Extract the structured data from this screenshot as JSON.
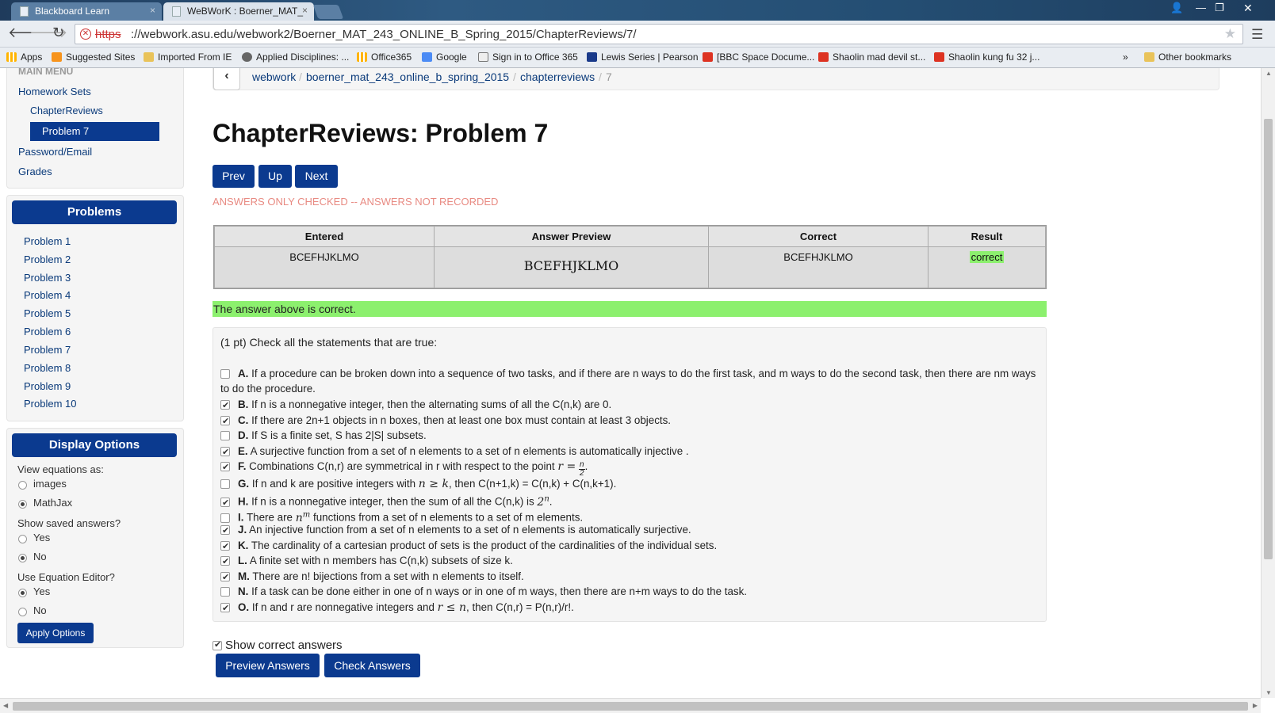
{
  "browser": {
    "tabs": [
      {
        "title": "Blackboard Learn"
      },
      {
        "title": "WeBWorK : Boerner_MAT_"
      }
    ],
    "url_protocol": "https",
    "url_rest": "://webwork.asu.edu/webwork2/Boerner_MAT_243_ONLINE_B_Spring_2015/ChapterReviews/7/",
    "bookmarks": [
      {
        "label": "Apps",
        "icon": "grid-icon"
      },
      {
        "label": "Suggested Sites",
        "icon": "suggested-icon"
      },
      {
        "label": "Imported From IE",
        "icon": "folder-icon"
      },
      {
        "label": "Applied Disciplines: ...",
        "icon": "applied-icon"
      },
      {
        "label": "Office365",
        "icon": "office-icon"
      },
      {
        "label": "Google",
        "icon": "google-icon"
      },
      {
        "label": "Sign in to Office 365",
        "icon": "page-icon"
      },
      {
        "label": "Lewis Series | Pearson",
        "icon": "pearson-icon"
      },
      {
        "label": "[BBC Space Docume...",
        "icon": "youtube-icon"
      },
      {
        "label": "Shaolin mad devil st...",
        "icon": "youtube-icon"
      },
      {
        "label": "Shaolin kung fu 32 j...",
        "icon": "youtube-icon"
      },
      {
        "label": "Other bookmarks",
        "icon": "folder-icon"
      }
    ],
    "more_bookmarks": "»"
  },
  "sidebar": {
    "main_menu": "MAIN MENU",
    "homework_sets": "Homework Sets",
    "chapter_reviews": "ChapterReviews",
    "active_problem": "Problem 7",
    "password_email": "Password/Email",
    "grades": "Grades",
    "problems_title": "Problems",
    "problems": [
      "Problem 1",
      "Problem 2",
      "Problem 3",
      "Problem 4",
      "Problem 5",
      "Problem 6",
      "Problem 7",
      "Problem 8",
      "Problem 9",
      "Problem 10"
    ],
    "display_title": "Display Options",
    "view_eq_label": "View equations as:",
    "view_eq_opts": [
      "images",
      "MathJax"
    ],
    "show_saved_label": "Show saved answers?",
    "show_saved_opts": [
      "Yes",
      "No"
    ],
    "eq_editor_label": "Use Equation Editor?",
    "eq_editor_opts": [
      "Yes",
      "No"
    ],
    "apply_label": "Apply Options"
  },
  "breadcrumb": {
    "back": "‹",
    "items": [
      "webwork",
      "boerner_mat_243_online_b_spring_2015",
      "chapterreviews"
    ],
    "current": "7",
    "sep": "/"
  },
  "main": {
    "title": "ChapterReviews: Problem 7",
    "prev": "Prev",
    "up": "Up",
    "next": "Next",
    "status": "ANSWERS ONLY CHECKED -- ANSWERS NOT RECORDED",
    "results_headers": [
      "Entered",
      "Answer Preview",
      "Correct",
      "Result"
    ],
    "results_row": {
      "entered": "BCEFHJKLMO",
      "preview": "BCEFHJKLMO",
      "correct": "BCEFHJKLMO",
      "result": "correct"
    },
    "correct_banner": "The answer above is correct.",
    "problem_intro": "(1 pt) Check all the statements that are true:",
    "statements": [
      {
        "label": "A.",
        "text": "If a procedure can be broken down into a sequence of two tasks, and if there are n ways to do the first task, and m ways to do the second task, then there are nm ways to do the procedure.",
        "checked": false
      },
      {
        "label": "B.",
        "text": "If n is a nonnegative integer, then the alternating sums of all the C(n,k) are 0.",
        "checked": true
      },
      {
        "label": "C.",
        "text": "If there are 2n+1 objects in n boxes, then at least one box must contain at least 3 objects.",
        "checked": true
      },
      {
        "label": "D.",
        "text": "If S is a finite set, S has 2|S| subsets.",
        "checked": false
      },
      {
        "label": "E.",
        "text": "A surjective function from a set of n elements to a set of n elements is automatically injective .",
        "checked": true
      },
      {
        "label": "F.",
        "text_before": "Combinations C(n,r) are symmetrical in r with respect to the point",
        "math": "r =",
        "frac_num": "n",
        "frac_den": "2",
        "text_after": ".",
        "checked": true
      },
      {
        "label": "G.",
        "text_before": "If n and k are positive integers with",
        "math": "n ≥ k",
        "text_after": ", then C(n+1,k) = C(n,k) + C(n,k+1).",
        "checked": false
      },
      {
        "label": "H.",
        "text_before": "If n is a nonnegative integer, then the sum of all the C(n,k) is",
        "math_base": "2",
        "math_sup": "n",
        "text_after": ".",
        "checked": true
      },
      {
        "label": "I.",
        "text_before": "There are",
        "math_base": "n",
        "math_sup": "m",
        "text_after": "functions from a set of n elements to a set of m elements.",
        "checked": false
      },
      {
        "label": "J.",
        "text": "An injective function from a set of n elements to a set of n elements is automatically surjective.",
        "checked": true
      },
      {
        "label": "K.",
        "text": "The cardinality of a cartesian product of sets is the product of the cardinalities of the individual sets.",
        "checked": true
      },
      {
        "label": "L.",
        "text": "A finite set with n members has C(n,k) subsets of size k.",
        "checked": true
      },
      {
        "label": "M.",
        "text": "There are n! bijections from a set with n elements to itself.",
        "checked": true
      },
      {
        "label": "N.",
        "text": "If a task can be done either in one of n ways or in one of m ways, then there are n+m ways to do the task.",
        "checked": false
      },
      {
        "label": "O.",
        "text_before": "If n and r are nonnegative integers and",
        "math": "r ≤ n",
        "text_after": ", then C(n,r) = P(n,r)/r!.",
        "checked": true
      }
    ],
    "show_correct_label": "Show correct answers",
    "preview_btn": "Preview Answers",
    "check_btn": "Check Answers"
  },
  "colors": {
    "accent": "#0b3a8f",
    "correct": "#8cf06e",
    "status": "#e88a82"
  }
}
